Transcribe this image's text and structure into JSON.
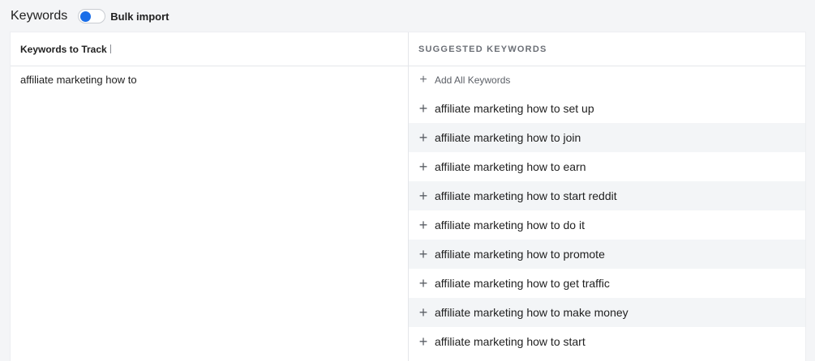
{
  "header": {
    "title": "Keywords",
    "bulk_import_label": "Bulk import",
    "bulk_import_enabled": false
  },
  "left_panel": {
    "title": "Keywords to Track",
    "textarea_value": "affiliate marketing how to"
  },
  "right_panel": {
    "title": "SUGGESTED KEYWORDS",
    "add_all_label": "Add All Keywords",
    "suggestions": [
      "affiliate marketing how to set up",
      "affiliate marketing how to join",
      "affiliate marketing how to earn",
      "affiliate marketing how to start reddit",
      "affiliate marketing how to do it",
      "affiliate marketing how to promote",
      "affiliate marketing how to get traffic",
      "affiliate marketing how to make money",
      "affiliate marketing how to start"
    ]
  },
  "colors": {
    "accent": "#1a6ee8",
    "row_alt_bg": "#f3f5f7",
    "page_bg": "#f4f5f7"
  },
  "icons": {
    "add": "plus-icon"
  }
}
